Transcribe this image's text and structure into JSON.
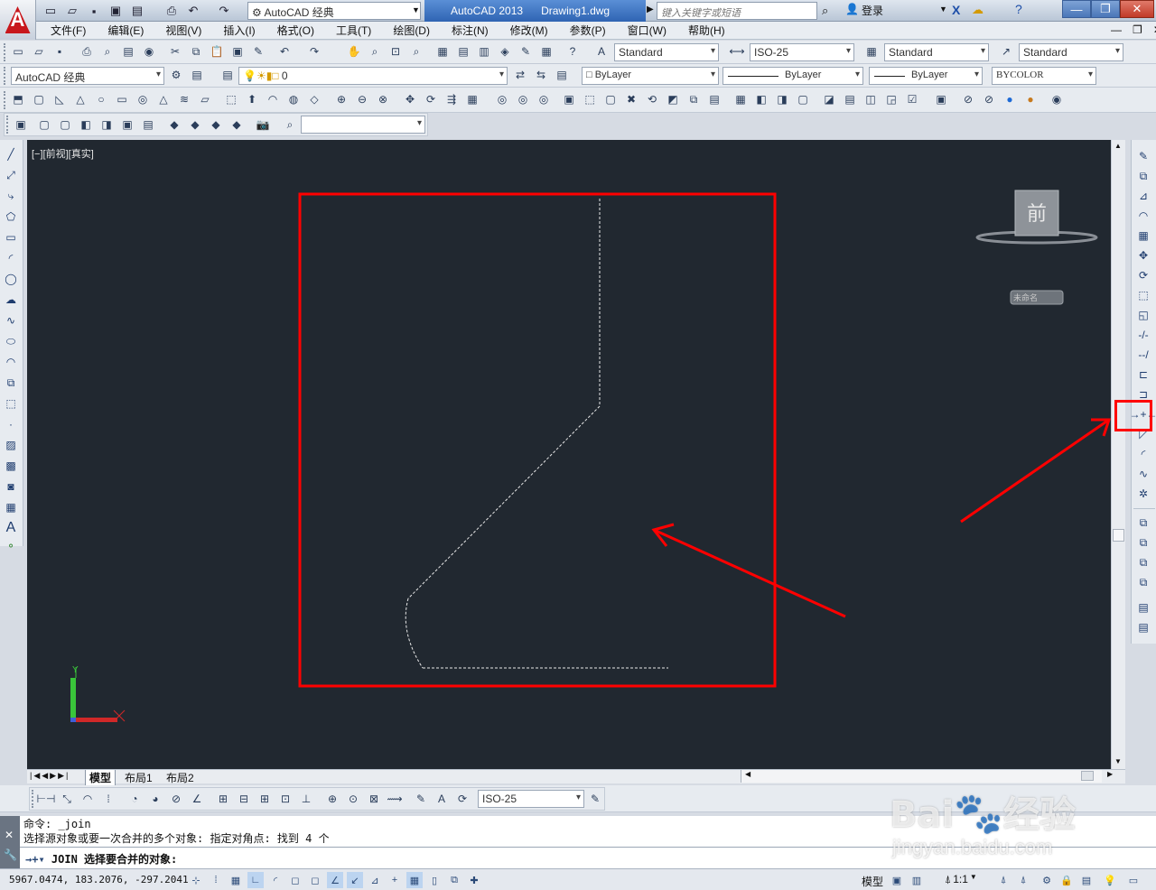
{
  "window": {
    "workspace": "AutoCAD 经典",
    "app_title": "AutoCAD 2013",
    "doc_title": "Drawing1.dwg",
    "search_placeholder": "键入关键字或短语",
    "login": "登录"
  },
  "menu": [
    "文件(F)",
    "编辑(E)",
    "视图(V)",
    "插入(I)",
    "格式(O)",
    "工具(T)",
    "绘图(D)",
    "标注(N)",
    "修改(M)",
    "参数(P)",
    "窗口(W)",
    "帮助(H)"
  ],
  "styles": {
    "text_style": "Standard",
    "dim_style": "ISO-25",
    "table_style": "Standard",
    "mleader_style": "Standard"
  },
  "layers": {
    "workspace_combo": "AutoCAD 经典",
    "current_layer": "0",
    "color": "ByLayer",
    "linetype": "ByLayer",
    "lineweight": "ByLayer",
    "plotstyle": "BYCOLOR"
  },
  "viewport": {
    "label": "[−][前视][真实]",
    "viewcube_face": "前",
    "ucs_name": "未命名",
    "axis_y": "Y",
    "axis_x": "X"
  },
  "tabs": [
    "模型",
    "布局1",
    "布局2"
  ],
  "dim_toolbar": {
    "dimstyle": "ISO-25"
  },
  "command": {
    "history1": "命令: _join",
    "history2": "选择源对象或要一次合并的多个对象: 指定对角点: 找到 4 个",
    "prompt": "JOIN 选择要合并的对象:"
  },
  "status": {
    "coords": "5967.0474, 183.2076, -297.2041",
    "model": "模型",
    "scale": "1:1"
  },
  "watermark": {
    "brand": "Bai du 经验",
    "url": "jingyan.baidu.com"
  },
  "colors": {
    "canvas": "#212830",
    "highlight": "#ff0000",
    "titlebar": "#2f64b3"
  }
}
